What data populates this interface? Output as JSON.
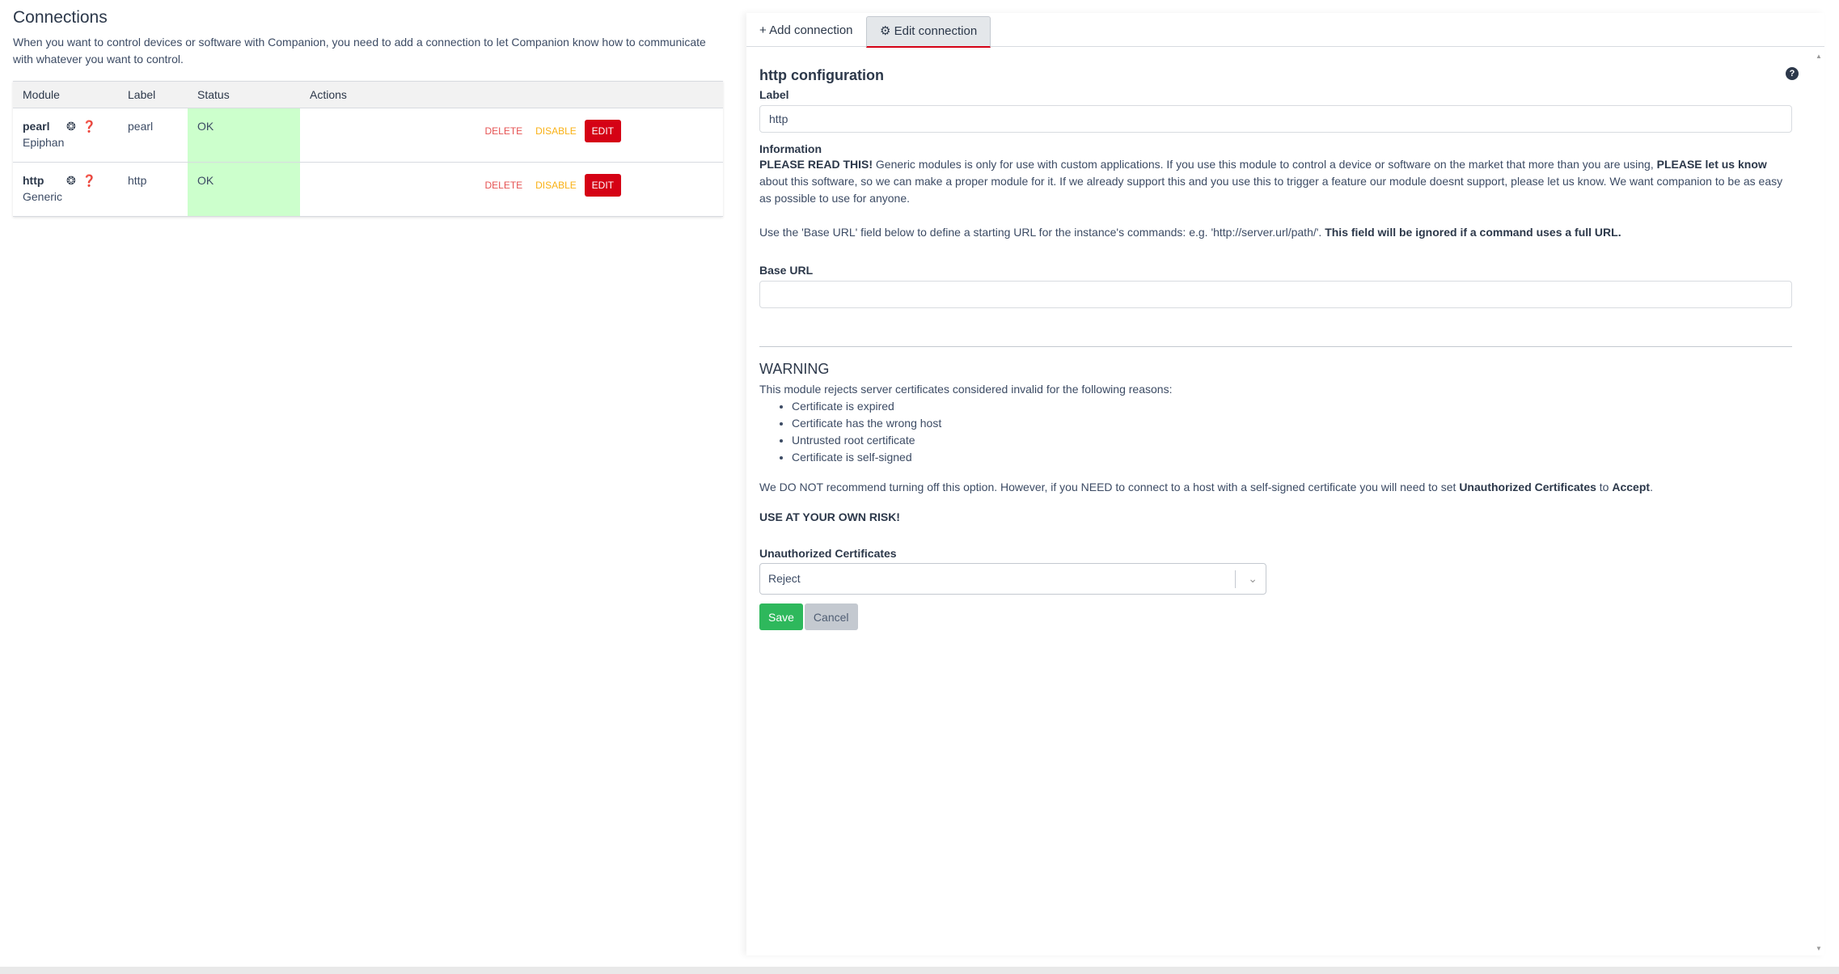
{
  "connections": {
    "title": "Connections",
    "description": "When you want to control devices or software with Companion, you need to add a connection to let Companion know how to communicate with whatever you want to control.",
    "columns": [
      "Module",
      "Label",
      "Status",
      "Actions"
    ],
    "rows": [
      {
        "module": "pearl",
        "module_sub": "Epiphan",
        "label": "pearl",
        "status": "OK",
        "delete": "DELETE",
        "disable": "DISABLE",
        "edit": "EDIT"
      },
      {
        "module": "http",
        "module_sub": "Generic",
        "label": "http",
        "status": "OK",
        "delete": "DELETE",
        "disable": "DISABLE",
        "edit": "EDIT"
      }
    ],
    "row_icons": "❂ ❓",
    "status_color": "#ccffcc"
  },
  "tabs": {
    "add": "+ Add connection",
    "edit": "⚙ Edit connection"
  },
  "config": {
    "title": "http configuration",
    "label_label": "Label",
    "label_value": "http",
    "info_label": "Information",
    "info_lead": "PLEASE READ THIS!",
    "info_text1": " Generic modules is only for use with custom applications. If you use this module to control a device or software on the market that more than you are using, ",
    "info_bold2": "PLEASE let us know",
    "info_text2": " about this software, so we can make a proper module for it. If we already support this and you use this to trigger a feature our module doesnt support, please let us know. We want companion to be as easy as possible to use for anyone.",
    "info_text3": "Use the 'Base URL' field below to define a starting URL for the instance's commands: e.g. 'http://server.url/path/'. ",
    "info_bold3": "This field will be ignored if a command uses a full URL.",
    "base_url_label": "Base URL",
    "base_url_value": "",
    "warning_title": "WARNING",
    "warning_intro": "This module rejects server certificates considered invalid for the following reasons:",
    "reasons": [
      "Certificate is expired",
      "Certificate has the wrong host",
      "Untrusted root certificate",
      "Certificate is self-signed"
    ],
    "recommend_text1": "We DO NOT recommend turning off this option. However, if you NEED to connect to a host with a self-signed certificate you will need to set ",
    "recommend_bold1": "Unauthorized Certificates",
    "recommend_text2": " to ",
    "recommend_bold2": "Accept",
    "recommend_text3": ".",
    "risk": "USE AT YOUR OWN RISK!",
    "cert_label": "Unauthorized Certificates",
    "cert_value": "Reject",
    "save": "Save",
    "cancel": "Cancel"
  },
  "colors": {
    "accent": "#d50215",
    "save": "#2eb85c",
    "delete": "#e55353",
    "disable": "#f9b115"
  }
}
